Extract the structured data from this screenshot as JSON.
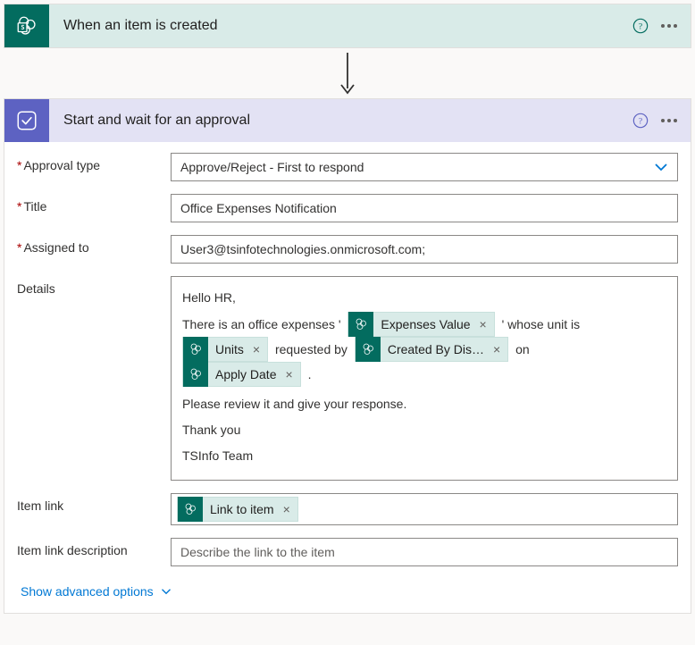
{
  "trigger": {
    "title": "When an item is created"
  },
  "approval": {
    "title": "Start and wait for an approval",
    "fields": {
      "approval_type_label": "Approval type",
      "approval_type_value": "Approve/Reject - First to respond",
      "title_label": "Title",
      "title_value": "Office Expenses Notification",
      "assigned_to_label": "Assigned to",
      "assigned_to_value": "User3@tsinfotechnologies.onmicrosoft.com;",
      "details_label": "Details",
      "details": {
        "line1": "Hello HR,",
        "line2_pre": "There is an office expenses '",
        "line2_post": "' whose unit is",
        "line3_mid": " requested by ",
        "line3_post": " on",
        "line4_post": ".",
        "line5": "Please review it and give your response.",
        "line6": "Thank you",
        "line7": "TSInfo Team"
      },
      "tokens": {
        "expenses_value": "Expenses Value",
        "units": "Units",
        "created_by": "Created By Dis…",
        "apply_date": "Apply Date",
        "link_to_item": "Link to item"
      },
      "item_link_label": "Item link",
      "item_link_desc_label": "Item link description",
      "item_link_desc_placeholder": "Describe the link to the item"
    },
    "advanced_label": "Show advanced options"
  }
}
